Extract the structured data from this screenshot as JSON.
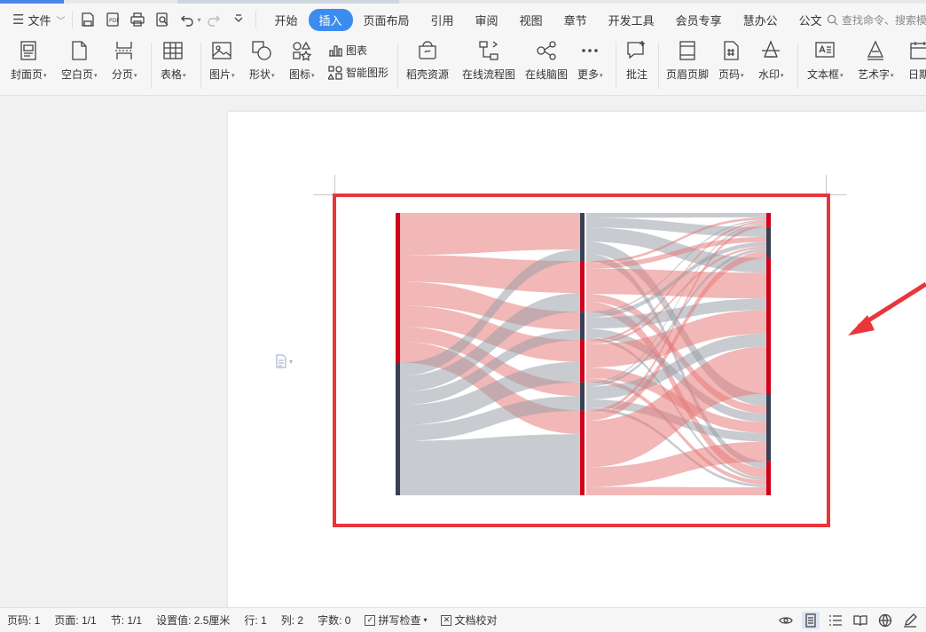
{
  "menubar": {
    "file_label": "文件",
    "tabs": [
      "开始",
      "插入",
      "页面布局",
      "引用",
      "审阅",
      "视图",
      "章节",
      "开发工具",
      "会员专享",
      "慧办公",
      "公文"
    ],
    "active_tab": "插入",
    "search_placeholder": "查找命令、搜索模"
  },
  "ribbon": {
    "cover": "封面页",
    "blank": "空白页",
    "pagebreak": "分页",
    "table": "表格",
    "picture": "图片",
    "shape": "形状",
    "icon": "图标",
    "chart": "图表",
    "smartart": "智能图形",
    "resources": "稻壳资源",
    "flowchart": "在线流程图",
    "mindmap": "在线脑图",
    "more": "更多",
    "comment": "批注",
    "headerfooter": "页眉页脚",
    "pagenum": "页码",
    "watermark": "水印",
    "textbox": "文本框",
    "wordart": "艺术字",
    "date": "日期"
  },
  "statusbar": {
    "page_num": "页码: 1",
    "pages": "页面: 1/1",
    "section": "节: 1/1",
    "setting": "设置值: 2.5厘米",
    "row": "行: 1",
    "col": "列: 2",
    "words": "字数: 0",
    "spellcheck": "拼写检查",
    "proofread": "文档校对"
  },
  "colors": {
    "accent": "#3c8cf0",
    "highlight_box": "#e8363a",
    "sankey_red": "#e87b7b",
    "sankey_gray": "#9aa0a8",
    "node_red": "#d0021b",
    "node_dark": "#3a3f52"
  },
  "chart_data": {
    "type": "sankey",
    "columns": 3,
    "nodes": [
      {
        "column": 0,
        "color": "red",
        "share": 0.53
      },
      {
        "column": 0,
        "color": "dark",
        "share": 0.47
      },
      {
        "column": 1,
        "color": "dark",
        "share": 0.17
      },
      {
        "column": 1,
        "color": "red",
        "share": 0.18
      },
      {
        "column": 1,
        "color": "dark",
        "share": 0.1
      },
      {
        "column": 1,
        "color": "red",
        "share": 0.15
      },
      {
        "column": 1,
        "color": "dark",
        "share": 0.1
      },
      {
        "column": 1,
        "color": "red",
        "share": 0.3
      },
      {
        "column": 2,
        "color": "red",
        "share": 0.05
      },
      {
        "column": 2,
        "color": "dark",
        "share": 0.11
      },
      {
        "column": 2,
        "color": "red",
        "share": 0.48
      },
      {
        "column": 2,
        "color": "dark",
        "share": 0.24
      },
      {
        "column": 2,
        "color": "red",
        "share": 0.12
      }
    ]
  }
}
